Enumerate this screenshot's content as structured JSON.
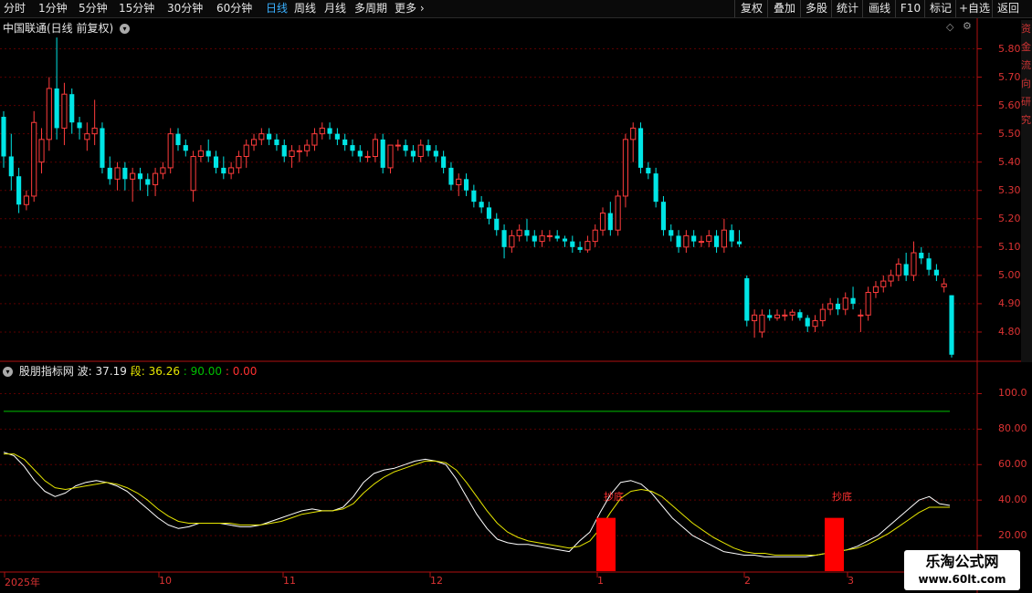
{
  "toolbar": {
    "tabs": [
      "分时",
      "1分钟",
      "5分钟",
      "15分钟",
      "30分钟",
      "60分钟",
      "日线",
      "周线",
      "月线",
      "多周期",
      "更多"
    ],
    "active_tab": "日线",
    "right_buttons": [
      "复权",
      "叠加",
      "多股",
      "统计",
      "画线",
      "F10",
      "标记",
      "+自选",
      "返回"
    ]
  },
  "price_panel": {
    "title": "中国联通(日线 前复权)",
    "y_ticks": [
      "5.80",
      "5.70",
      "5.60",
      "5.50",
      "5.40",
      "5.30",
      "5.20",
      "5.10",
      "5.00",
      "4.90",
      "4.80"
    ]
  },
  "indicator_panel": {
    "name": "股朋指标网",
    "bo_label": "波:",
    "bo_value": "37.19",
    "duan_label": "段:",
    "duan_value": "36.26",
    "val3": ": 90.00",
    "val4": ": 0.00",
    "y_ticks": [
      "100.0",
      "80.00",
      "60.00",
      "40.00",
      "20.00"
    ],
    "signal_label": "抄底"
  },
  "x_axis": [
    "2025年",
    "10",
    "11",
    "12",
    "1",
    "2",
    "3"
  ],
  "side_column_text": "资金流向研究",
  "watermark": {
    "line1": "乐淘公式网",
    "line2": "www.60lt.com"
  },
  "colors": {
    "up": "#ff3c3c",
    "down": "#00e5e5",
    "wave": "#ffffff",
    "seg": "#e6e600",
    "line90": "#00c000",
    "signal": "#ff0000"
  },
  "chart_data": [
    {
      "type": "candlestick",
      "title": "中国联通(日线 前复权)",
      "ylim": [
        4.7,
        5.85
      ],
      "candles_ohlc": [
        [
          5.56,
          5.58,
          5.38,
          5.42
        ],
        [
          5.42,
          5.5,
          5.3,
          5.35
        ],
        [
          5.35,
          5.38,
          5.22,
          5.25
        ],
        [
          5.25,
          5.3,
          5.23,
          5.28
        ],
        [
          5.28,
          5.58,
          5.26,
          5.54
        ],
        [
          5.4,
          5.52,
          5.36,
          5.48
        ],
        [
          5.48,
          5.7,
          5.44,
          5.66
        ],
        [
          5.66,
          5.84,
          5.48,
          5.52
        ],
        [
          5.52,
          5.68,
          5.46,
          5.64
        ],
        [
          5.64,
          5.66,
          5.5,
          5.54
        ],
        [
          5.54,
          5.56,
          5.48,
          5.52
        ],
        [
          5.48,
          5.54,
          5.44,
          5.5
        ],
        [
          5.5,
          5.62,
          5.46,
          5.52
        ],
        [
          5.52,
          5.54,
          5.36,
          5.38
        ],
        [
          5.38,
          5.42,
          5.32,
          5.34
        ],
        [
          5.34,
          5.4,
          5.3,
          5.38
        ],
        [
          5.38,
          5.4,
          5.3,
          5.34
        ],
        [
          5.34,
          5.38,
          5.26,
          5.36
        ],
        [
          5.36,
          5.38,
          5.3,
          5.34
        ],
        [
          5.34,
          5.36,
          5.28,
          5.32
        ],
        [
          5.32,
          5.38,
          5.28,
          5.36
        ],
        [
          5.36,
          5.4,
          5.34,
          5.38
        ],
        [
          5.38,
          5.52,
          5.36,
          5.5
        ],
        [
          5.5,
          5.52,
          5.44,
          5.46
        ],
        [
          5.46,
          5.48,
          5.42,
          5.44
        ],
        [
          5.3,
          5.44,
          5.26,
          5.42
        ],
        [
          5.42,
          5.46,
          5.4,
          5.44
        ],
        [
          5.44,
          5.48,
          5.4,
          5.42
        ],
        [
          5.42,
          5.44,
          5.36,
          5.38
        ],
        [
          5.38,
          5.42,
          5.34,
          5.36
        ],
        [
          5.36,
          5.4,
          5.34,
          5.38
        ],
        [
          5.38,
          5.44,
          5.36,
          5.42
        ],
        [
          5.42,
          5.48,
          5.38,
          5.46
        ],
        [
          5.46,
          5.5,
          5.44,
          5.48
        ],
        [
          5.48,
          5.52,
          5.46,
          5.5
        ],
        [
          5.5,
          5.52,
          5.46,
          5.48
        ],
        [
          5.48,
          5.5,
          5.44,
          5.46
        ],
        [
          5.46,
          5.48,
          5.4,
          5.42
        ],
        [
          5.42,
          5.46,
          5.38,
          5.44
        ],
        [
          5.44,
          5.46,
          5.4,
          5.44
        ],
        [
          5.44,
          5.48,
          5.42,
          5.46
        ],
        [
          5.46,
          5.52,
          5.44,
          5.5
        ],
        [
          5.5,
          5.54,
          5.48,
          5.52
        ],
        [
          5.52,
          5.54,
          5.48,
          5.5
        ],
        [
          5.5,
          5.52,
          5.46,
          5.48
        ],
        [
          5.48,
          5.5,
          5.44,
          5.46
        ],
        [
          5.46,
          5.48,
          5.42,
          5.44
        ],
        [
          5.44,
          5.46,
          5.4,
          5.42
        ],
        [
          5.42,
          5.44,
          5.4,
          5.42
        ],
        [
          5.42,
          5.5,
          5.4,
          5.48
        ],
        [
          5.48,
          5.5,
          5.36,
          5.38
        ],
        [
          5.38,
          5.46,
          5.36,
          5.46
        ],
        [
          5.46,
          5.48,
          5.44,
          5.46
        ],
        [
          5.46,
          5.48,
          5.42,
          5.44
        ],
        [
          5.44,
          5.46,
          5.4,
          5.42
        ],
        [
          5.42,
          5.48,
          5.4,
          5.46
        ],
        [
          5.46,
          5.48,
          5.42,
          5.44
        ],
        [
          5.44,
          5.46,
          5.4,
          5.42
        ],
        [
          5.42,
          5.44,
          5.36,
          5.38
        ],
        [
          5.38,
          5.4,
          5.3,
          5.32
        ],
        [
          5.32,
          5.36,
          5.28,
          5.34
        ],
        [
          5.34,
          5.36,
          5.28,
          5.3
        ],
        [
          5.3,
          5.32,
          5.24,
          5.26
        ],
        [
          5.26,
          5.28,
          5.22,
          5.24
        ],
        [
          5.24,
          5.26,
          5.18,
          5.2
        ],
        [
          5.2,
          5.22,
          5.14,
          5.16
        ],
        [
          5.16,
          5.18,
          5.06,
          5.1
        ],
        [
          5.1,
          5.16,
          5.08,
          5.14
        ],
        [
          5.14,
          5.18,
          5.12,
          5.16
        ],
        [
          5.16,
          5.2,
          5.12,
          5.14
        ],
        [
          5.14,
          5.16,
          5.1,
          5.12
        ],
        [
          5.12,
          5.16,
          5.1,
          5.14
        ],
        [
          5.14,
          5.16,
          5.12,
          5.14
        ],
        [
          5.14,
          5.16,
          5.12,
          5.13
        ],
        [
          5.13,
          5.14,
          5.1,
          5.12
        ],
        [
          5.12,
          5.14,
          5.08,
          5.1
        ],
        [
          5.1,
          5.12,
          5.08,
          5.09
        ],
        [
          5.09,
          5.14,
          5.08,
          5.12
        ],
        [
          5.12,
          5.18,
          5.1,
          5.16
        ],
        [
          5.16,
          5.24,
          5.14,
          5.22
        ],
        [
          5.22,
          5.26,
          5.14,
          5.16
        ],
        [
          5.16,
          5.3,
          5.14,
          5.28
        ],
        [
          5.28,
          5.5,
          5.24,
          5.48
        ],
        [
          5.48,
          5.54,
          5.4,
          5.52
        ],
        [
          5.52,
          5.54,
          5.36,
          5.38
        ],
        [
          5.38,
          5.4,
          5.34,
          5.36
        ],
        [
          5.36,
          5.38,
          5.24,
          5.26
        ],
        [
          5.26,
          5.28,
          5.14,
          5.16
        ],
        [
          5.16,
          5.18,
          5.12,
          5.14
        ],
        [
          5.14,
          5.16,
          5.08,
          5.1
        ],
        [
          5.1,
          5.16,
          5.08,
          5.14
        ],
        [
          5.14,
          5.16,
          5.1,
          5.12
        ],
        [
          5.12,
          5.14,
          5.1,
          5.12
        ],
        [
          5.12,
          5.16,
          5.1,
          5.14
        ],
        [
          5.14,
          5.16,
          5.08,
          5.1
        ],
        [
          5.1,
          5.2,
          5.08,
          5.16
        ],
        [
          5.16,
          5.18,
          5.1,
          5.12
        ],
        [
          5.12,
          5.16,
          5.1,
          5.11
        ],
        [
          4.99,
          5.0,
          4.82,
          4.84
        ],
        [
          4.84,
          4.88,
          4.78,
          4.86
        ],
        [
          4.8,
          4.88,
          4.78,
          4.86
        ],
        [
          4.86,
          4.88,
          4.84,
          4.85
        ],
        [
          4.85,
          4.88,
          4.84,
          4.86
        ],
        [
          4.86,
          4.88,
          4.84,
          4.86
        ],
        [
          4.86,
          4.88,
          4.84,
          4.87
        ],
        [
          4.87,
          4.88,
          4.84,
          4.85
        ],
        [
          4.85,
          4.86,
          4.8,
          4.82
        ],
        [
          4.82,
          4.86,
          4.8,
          4.84
        ],
        [
          4.84,
          4.9,
          4.82,
          4.88
        ],
        [
          4.88,
          4.92,
          4.86,
          4.9
        ],
        [
          4.9,
          4.92,
          4.86,
          4.88
        ],
        [
          4.88,
          4.94,
          4.86,
          4.92
        ],
        [
          4.92,
          4.96,
          4.88,
          4.9
        ],
        [
          4.86,
          4.88,
          4.8,
          4.86
        ],
        [
          4.86,
          4.96,
          4.84,
          4.94
        ],
        [
          4.94,
          4.98,
          4.92,
          4.96
        ],
        [
          4.96,
          5.0,
          4.94,
          4.98
        ],
        [
          4.98,
          5.02,
          4.96,
          5.0
        ],
        [
          5.0,
          5.06,
          4.98,
          5.04
        ],
        [
          5.04,
          5.08,
          4.98,
          5.0
        ],
        [
          5.0,
          5.12,
          4.98,
          5.08
        ],
        [
          5.08,
          5.1,
          5.04,
          5.06
        ],
        [
          5.06,
          5.08,
          5.0,
          5.02
        ],
        [
          5.02,
          5.04,
          4.98,
          5.0
        ],
        [
          4.96,
          4.99,
          4.94,
          4.97
        ],
        [
          4.93,
          4.93,
          4.71,
          4.72
        ]
      ]
    },
    {
      "type": "line",
      "title": "股朋指标网",
      "ylim": [
        0,
        110
      ],
      "series": [
        {
          "name": "波",
          "values": [
            67,
            65,
            59,
            51,
            45,
            42,
            44,
            48,
            50,
            51,
            50,
            48,
            45,
            40,
            35,
            30,
            26,
            24,
            25,
            27,
            27,
            27,
            26,
            25,
            25,
            26,
            28,
            30,
            32,
            34,
            35,
            34,
            34,
            36,
            42,
            50,
            55,
            57,
            58,
            60,
            62,
            63,
            62,
            60,
            52,
            42,
            32,
            24,
            18,
            16,
            15,
            15,
            14,
            13,
            12,
            11,
            17,
            22,
            33,
            43,
            50,
            51,
            49,
            44,
            37,
            30,
            25,
            20,
            17,
            14,
            11,
            10,
            9,
            9,
            8,
            8,
            8,
            8,
            8,
            9,
            10,
            11,
            12,
            14,
            17,
            20,
            25,
            30,
            35,
            40,
            42,
            38,
            37
          ]
        },
        {
          "name": "段",
          "values": [
            66,
            66,
            63,
            57,
            51,
            47,
            46,
            47,
            48,
            49,
            50,
            49,
            47,
            44,
            40,
            35,
            31,
            28,
            27,
            27,
            27,
            27,
            27,
            26,
            26,
            26,
            27,
            28,
            30,
            32,
            33,
            34,
            34,
            35,
            38,
            44,
            49,
            53,
            56,
            58,
            60,
            62,
            62,
            61,
            57,
            50,
            42,
            34,
            27,
            22,
            19,
            17,
            16,
            15,
            14,
            13,
            14,
            17,
            24,
            33,
            41,
            45,
            46,
            45,
            42,
            37,
            32,
            27,
            23,
            19,
            16,
            13,
            11,
            10,
            10,
            9,
            9,
            9,
            9,
            9,
            10,
            11,
            12,
            13,
            15,
            18,
            21,
            25,
            29,
            33,
            36,
            36,
            36
          ]
        },
        {
          "name": "90.00",
          "values": [
            90
          ]
        }
      ],
      "signals": [
        {
          "label": "抄底",
          "value": 30
        },
        {
          "label": "抄底",
          "value": 30
        }
      ]
    }
  ]
}
